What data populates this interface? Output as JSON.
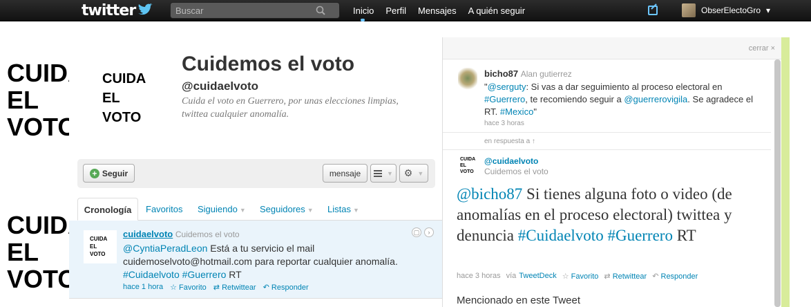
{
  "topbar": {
    "logo_text": "twitter",
    "search_placeholder": "Buscar",
    "nav": [
      "Inicio",
      "Perfil",
      "Mensajes",
      "A quién seguir"
    ],
    "account_name": "ObserElectoGro",
    "account_caret": "▾"
  },
  "background_logo": [
    "CUIDA",
    "EL",
    "VOTO"
  ],
  "profile": {
    "avatar_lines": [
      "CUIDA",
      "EL",
      "VOTO"
    ],
    "name": "Cuidemos el voto",
    "handle": "@cuidaelvoto",
    "bio": "Cuida el voto en Guerrero, por unas elecciones limpias, twittea cualquier anomalía.",
    "follow_label": "Seguir",
    "message_label": "mensaje",
    "tabs": [
      "Cronología",
      "Favoritos",
      "Siguiendo",
      "Seguidores",
      "Listas"
    ]
  },
  "timeline_tweet": {
    "avatar_lines": [
      "CUIDA",
      "EL",
      "VOTO"
    ],
    "username": "cuidaelvoto",
    "fullname": "Cuidemos el voto",
    "mention": "@CyntiaPeradLeon",
    "text_rest": " Está a tu servicio el mail cuidemoselvoto@hotmail.com para reportar cualquier anomalía.",
    "hashtags": "#Cuidaelvoto #Guerrero",
    "text_end": " RT",
    "time": "hace 1 hora",
    "fav": "Favorito",
    "rt": "Retwittear",
    "reply": "Responder"
  },
  "detail": {
    "close_label": "cerrar",
    "close_icon": "×",
    "parent": {
      "username": "bicho87",
      "fullname": "Alan gutierrez",
      "quote_open": "\"",
      "mention1": "@serguty",
      "t1": ": Si vas a dar seguimiento al proceso electoral en ",
      "hashtag1": "#Guerrero",
      "t2": ", te recomiendo seguir a ",
      "mention2": "@guerrerovigila",
      "t3": ". Se agradece el RT. ",
      "hashtag2": "#Mexico",
      "quote_close": "\"",
      "time": "hace 3 horas"
    },
    "in_reply_label": "en respuesta a ↑",
    "main": {
      "avatar_lines": [
        "CUIDA",
        "EL",
        "VOTO"
      ],
      "handle": "@cuidaelvoto",
      "fullname": "Cuidemos el voto",
      "mention": "@bicho87",
      "text_mid": " Si tienes alguna foto o video (de anomalías en el proceso electoral) twittea y denuncia ",
      "hashtag1": "#Cuidaelvoto",
      "space": " ",
      "hashtag2": "#Guerrero",
      "text_end": " RT",
      "time": "hace 3 horas",
      "via_label": "vía",
      "client": "TweetDeck",
      "fav": "Favorito",
      "rt": "Retwittear",
      "reply": "Responder"
    },
    "mentioned_label": "Mencionado en este Tweet"
  }
}
